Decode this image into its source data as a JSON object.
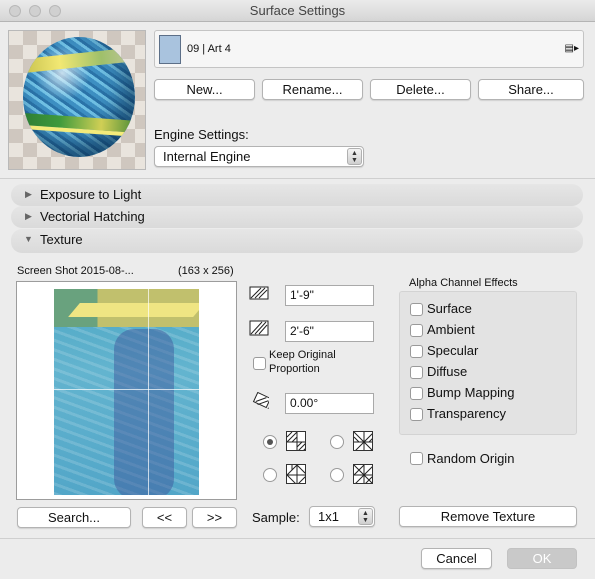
{
  "window": {
    "title": "Surface Settings"
  },
  "material": {
    "name": "09 | Art 4",
    "swatch_color": "#a9c3de"
  },
  "buttons": {
    "new": "New...",
    "rename": "Rename...",
    "delete": "Delete...",
    "share": "Share..."
  },
  "engine": {
    "label": "Engine Settings:",
    "value": "Internal Engine"
  },
  "sections": {
    "exposure": "Exposure to Light",
    "hatching": "Vectorial Hatching",
    "texture": "Texture"
  },
  "texture": {
    "filename": "Screen Shot 2015-08-...",
    "size": "(163 x 256)",
    "width": "1'-9\"",
    "height": "2'-6\"",
    "keep_proportion_line1": "Keep Original",
    "keep_proportion_line2": "Proportion",
    "angle": "0.00°",
    "search_label": "Search...",
    "prev_label": "<<",
    "next_label": ">>",
    "sample_label": "Sample:",
    "sample_value": "1x1",
    "remove_label": "Remove Texture"
  },
  "alpha": {
    "title": "Alpha Channel Effects",
    "options": [
      {
        "label": "Surface",
        "checked": false
      },
      {
        "label": "Ambient",
        "checked": false
      },
      {
        "label": "Specular",
        "checked": false
      },
      {
        "label": "Diffuse",
        "checked": false
      },
      {
        "label": "Bump Mapping",
        "checked": false
      },
      {
        "label": "Transparency",
        "checked": false
      }
    ],
    "random_origin": "Random Origin"
  },
  "footer": {
    "cancel": "Cancel",
    "ok": "OK"
  }
}
